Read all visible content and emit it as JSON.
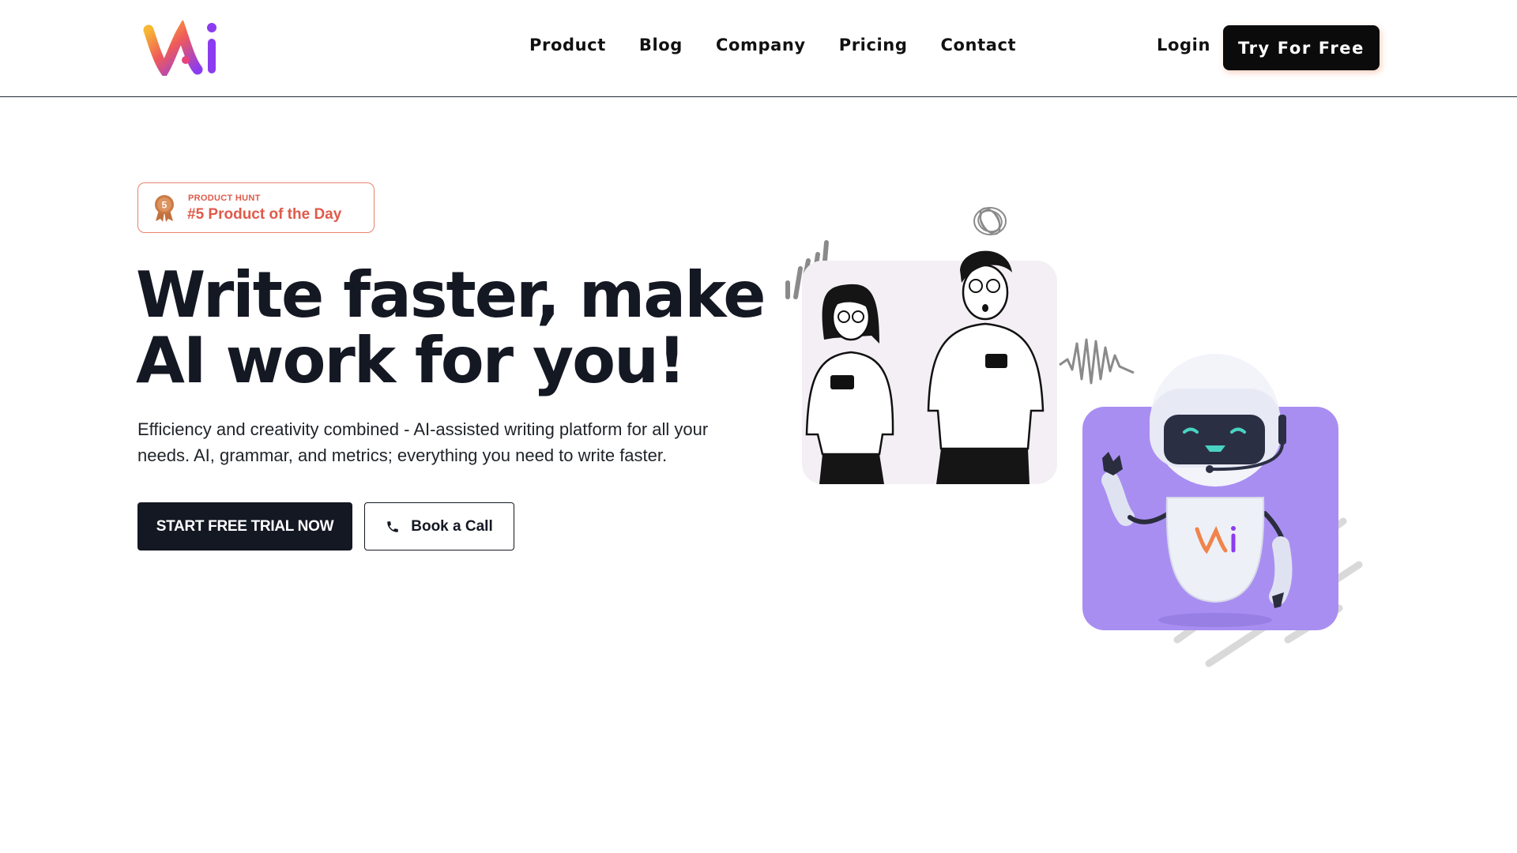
{
  "header": {
    "logo_icon": "vai-logo-icon",
    "nav": [
      "Product",
      "Blog",
      "Company",
      "Pricing",
      "Contact"
    ],
    "login_label": "Login",
    "try_label": "Try For Free"
  },
  "badge": {
    "icon": "medal-icon",
    "rank": "5",
    "small_label": "PRODUCT HUNT",
    "label": "#5 Product of the Day"
  },
  "hero": {
    "headline_line1": "Write faster, make",
    "headline_line2": "AI work for you!",
    "subtitle_line1": "Efficiency and creativity combined - AI-assisted writing platform for all your",
    "subtitle_line2": "needs. AI, grammar, and metrics; everything you need to write faster.",
    "primary_cta": "START FREE TRIAL NOW",
    "secondary_cta": "Book a Call",
    "secondary_cta_icon": "phone-icon"
  },
  "illustration": {
    "robot_logo": "vai-logo-icon",
    "people_card_color": "#f4eff5",
    "robot_card_color": "#a98ef2"
  },
  "colors": {
    "primary_dark": "#141823",
    "accent_red": "#e05a4a",
    "logo_orange": "#f59e3b",
    "logo_pink": "#e8427c",
    "logo_purple": "#8b3cf0"
  }
}
